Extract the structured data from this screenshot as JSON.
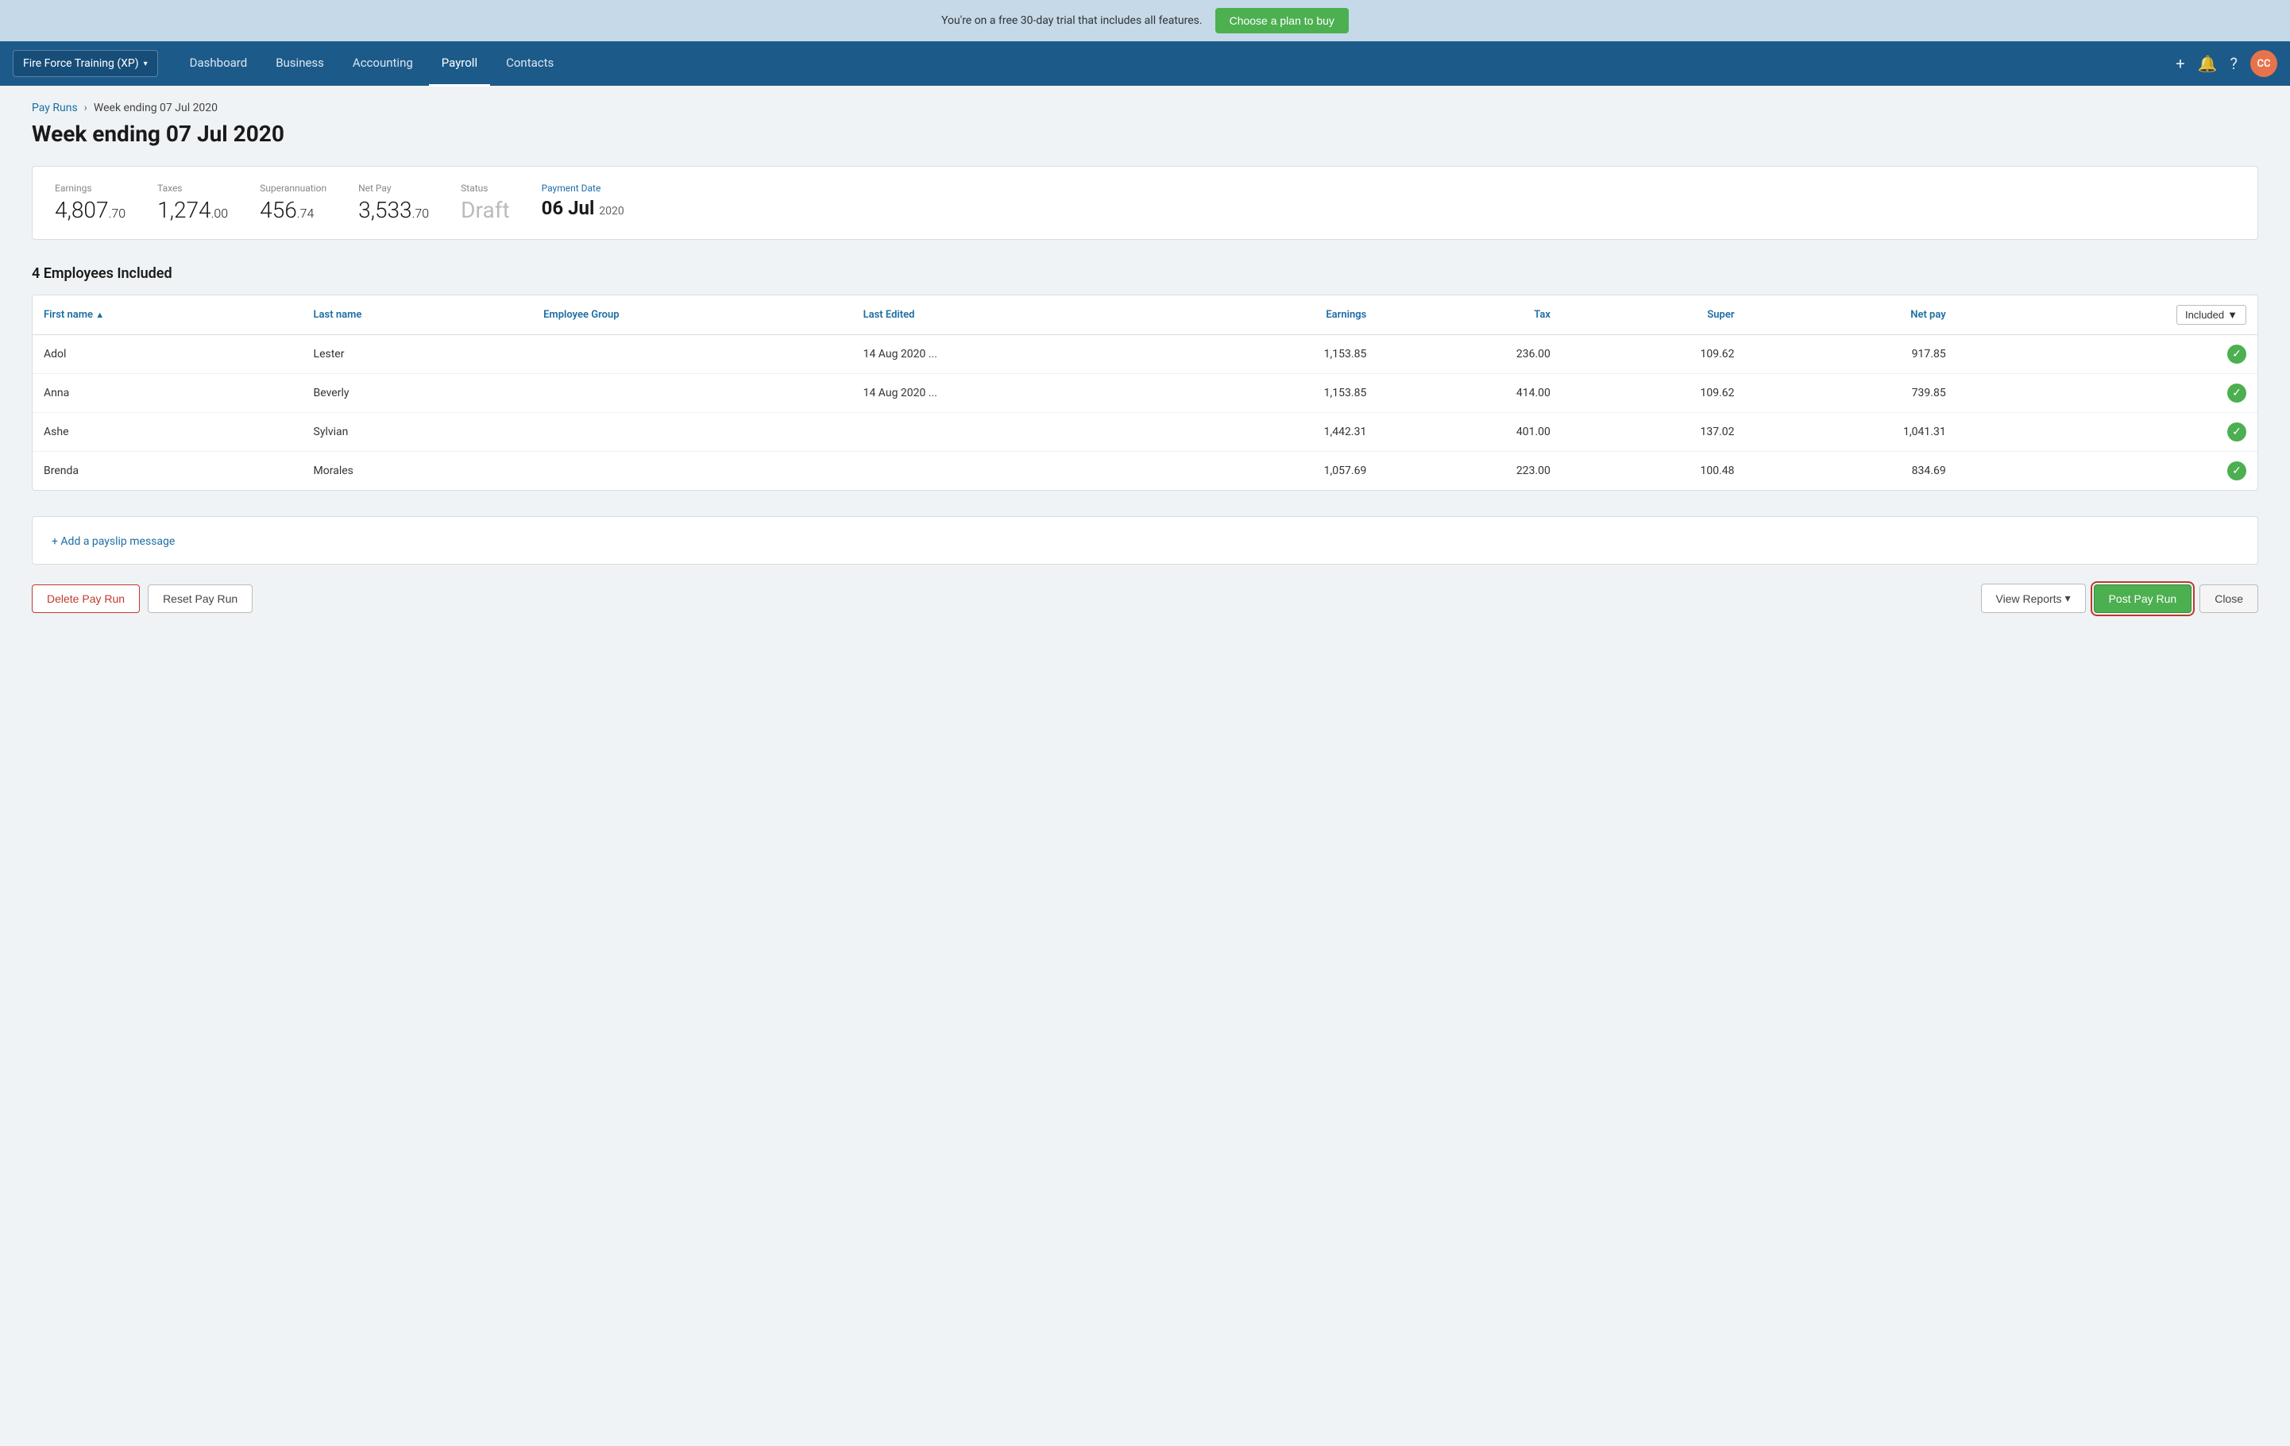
{
  "banner": {
    "message": "You're on a free 30-day trial that includes all features.",
    "cta_label": "Choose a plan to buy"
  },
  "navbar": {
    "org_name": "Fire Force Training (XP)",
    "links": [
      {
        "label": "Dashboard",
        "active": false
      },
      {
        "label": "Business",
        "active": false
      },
      {
        "label": "Accounting",
        "active": false
      },
      {
        "label": "Payroll",
        "active": true
      },
      {
        "label": "Contacts",
        "active": false
      }
    ],
    "avatar_initials": "CC"
  },
  "breadcrumb": {
    "parent_label": "Pay Runs",
    "separator": "›",
    "current": "Week ending 07 Jul 2020"
  },
  "page_title": "Week ending 07 Jul 2020",
  "summary": {
    "earnings_label": "Earnings",
    "earnings_whole": "4,807",
    "earnings_decimal": ".70",
    "taxes_label": "Taxes",
    "taxes_whole": "1,274",
    "taxes_decimal": ".00",
    "super_label": "Superannuation",
    "super_whole": "456",
    "super_decimal": ".74",
    "netpay_label": "Net Pay",
    "netpay_whole": "3,533",
    "netpay_decimal": ".70",
    "status_label": "Status",
    "status_value": "Draft",
    "payment_date_label": "Payment Date",
    "payment_date_day_month": "06 Jul",
    "payment_date_year": "2020"
  },
  "employees_section": {
    "title": "4 Employees Included",
    "columns": {
      "first_name": "First name",
      "sort_indicator": "▲",
      "last_name": "Last name",
      "employee_group": "Employee Group",
      "last_edited": "Last Edited",
      "earnings": "Earnings",
      "tax": "Tax",
      "super": "Super",
      "net_pay": "Net pay",
      "included_label": "Included",
      "included_dropdown": "▼"
    },
    "rows": [
      {
        "first_name": "Adol",
        "last_name": "Lester",
        "employee_group": "",
        "last_edited": "14 Aug 2020 ...",
        "earnings": "1,153.85",
        "tax": "236.00",
        "super": "109.62",
        "net_pay": "917.85",
        "included": true
      },
      {
        "first_name": "Anna",
        "last_name": "Beverly",
        "employee_group": "",
        "last_edited": "14 Aug 2020 ...",
        "earnings": "1,153.85",
        "tax": "414.00",
        "super": "109.62",
        "net_pay": "739.85",
        "included": true
      },
      {
        "first_name": "Ashe",
        "last_name": "Sylvian",
        "employee_group": "",
        "last_edited": "",
        "earnings": "1,442.31",
        "tax": "401.00",
        "super": "137.02",
        "net_pay": "1,041.31",
        "included": true
      },
      {
        "first_name": "Brenda",
        "last_name": "Morales",
        "employee_group": "",
        "last_edited": "",
        "earnings": "1,057.69",
        "tax": "223.00",
        "super": "100.48",
        "net_pay": "834.69",
        "included": true
      }
    ]
  },
  "payslip": {
    "add_link": "+ Add a payslip message"
  },
  "actions": {
    "delete_label": "Delete Pay Run",
    "reset_label": "Reset Pay Run",
    "view_reports_label": "View Reports",
    "post_label": "Post Pay Run",
    "close_label": "Close"
  }
}
